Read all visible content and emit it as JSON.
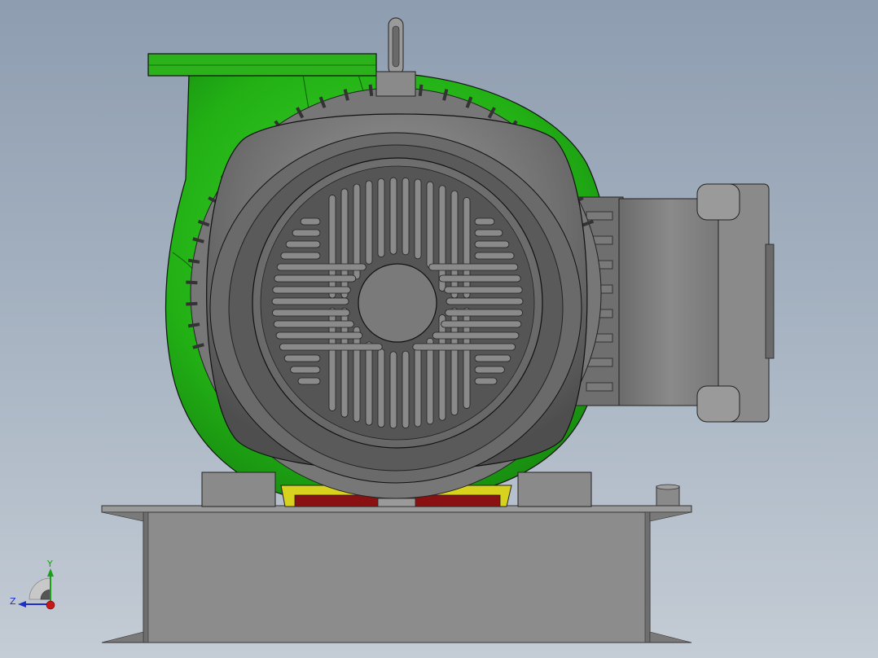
{
  "viewport": {
    "background_top": "#8e9db0",
    "background_bottom": "#c4ccd5"
  },
  "model": {
    "pump_volute_color": "#2bb21a",
    "motor_body_color": "#7f7f7f",
    "motor_dark_color": "#4a4a4a",
    "base_frame_color": "#8c8c8c",
    "coupling_guard_color": "#d6d21e",
    "flange_red_color": "#8a1111"
  },
  "triad": {
    "y_label": "Y",
    "z_label": "Z",
    "y_color": "#18a018",
    "z_color": "#1e2ec8",
    "x_color": "#c81818",
    "icon": "coordinate-triad-icon"
  }
}
